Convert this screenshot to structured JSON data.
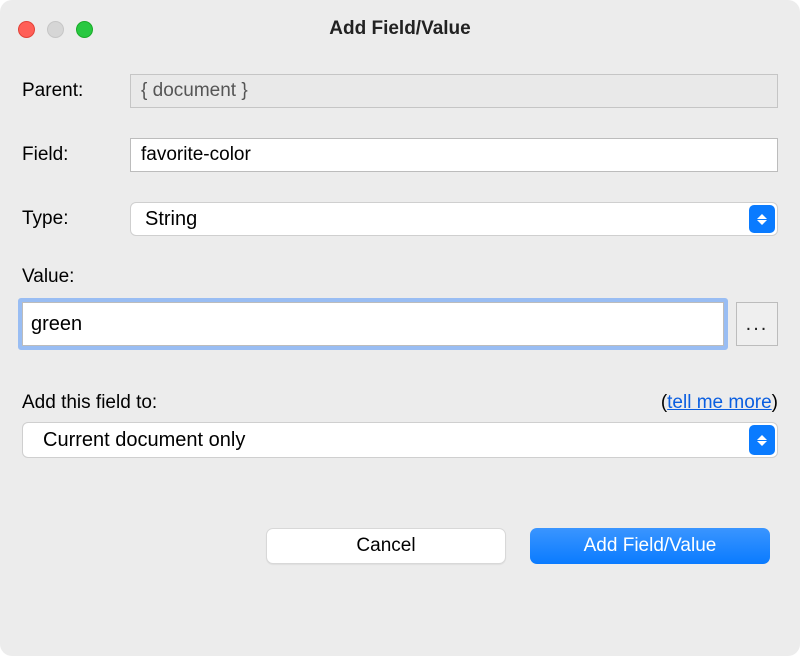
{
  "window": {
    "title": "Add Field/Value"
  },
  "labels": {
    "parent": "Parent:",
    "field": "Field:",
    "type": "Type:",
    "value": "Value:",
    "addFieldTo": "Add this field to:"
  },
  "fields": {
    "parent": "{ document }",
    "fieldName": "favorite-color",
    "type": "String",
    "value": "green",
    "addTo": "Current document only"
  },
  "hint": {
    "open": "(",
    "link": "tell me more",
    "close": ")"
  },
  "buttons": {
    "ellipsis": "...",
    "cancel": "Cancel",
    "submit": "Add Field/Value"
  }
}
